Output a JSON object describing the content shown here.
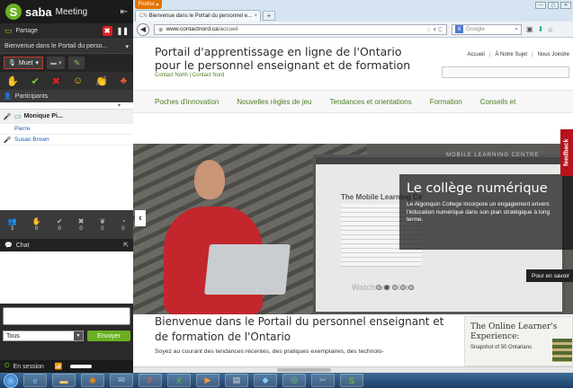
{
  "saba": {
    "brand": "saba",
    "meeting": "Meeting",
    "share_label": "Partage",
    "shared_item": "Bienvenue dans le Portail du perso...",
    "mute_label": "Muet",
    "participants_label": "Participants",
    "participants": [
      {
        "name": "Monique Pi...",
        "presenter": true
      },
      {
        "name": "Pierre",
        "presenter": false
      },
      {
        "name": "Susan Brown",
        "presenter": false
      }
    ],
    "stats": [
      {
        "value": "3"
      },
      {
        "value": "0"
      },
      {
        "value": "0"
      },
      {
        "value": "0"
      },
      {
        "value": "0"
      },
      {
        "value": "0"
      }
    ],
    "chat_label": "Chat",
    "recipient": "Tous",
    "send_label": "Envoyer",
    "status_label": "En session",
    "colors": {
      "accent": "#6ab023",
      "alert": "#e02020"
    }
  },
  "firefox": {
    "menu_button": "Firefox",
    "tab_title": "Bienvenue dans le Portail du personnel e...",
    "url_domain": "www.contactnord.ca",
    "url_path": "/accueil",
    "search_placeholder": "Google"
  },
  "page": {
    "title_line1": "Portail d'apprentissage en ligne de l'Ontario",
    "title_line2": "pour le personnel enseignant et de formation",
    "subtitle": "Contact North | Contact Nord",
    "toplinks": [
      "Accueil",
      "À Notre Sujet",
      "Nous Joindre"
    ],
    "menu": [
      "Poches d'innovation",
      "Nouvelles règles de jeu",
      "Tendances et orientations",
      "Formation",
      "Conseils et"
    ],
    "hero": {
      "heading": "Le collège numérique",
      "text": "Le Algonquin College incorpore un engagement envers l'éducation numérique dans son plan stratégique à long terme.",
      "more": "Pour en savoir",
      "feedback": "feedback",
      "mock_title": "The Mobile Learning Ce",
      "mock_watch": "Watch our video",
      "watermark": "MOBILE LEARNING CENTRE"
    },
    "welcome_title": "Bienvenue dans le Portail du personnel enseignant et de formation de l'Ontario",
    "welcome_desc": "Soyez au courant des tendances récentes, des pratiques exemplaires, des technolo-",
    "card": {
      "title": "The Online Learner's Experience:",
      "subtitle": "Snapshot of 50 Ontarians"
    }
  }
}
